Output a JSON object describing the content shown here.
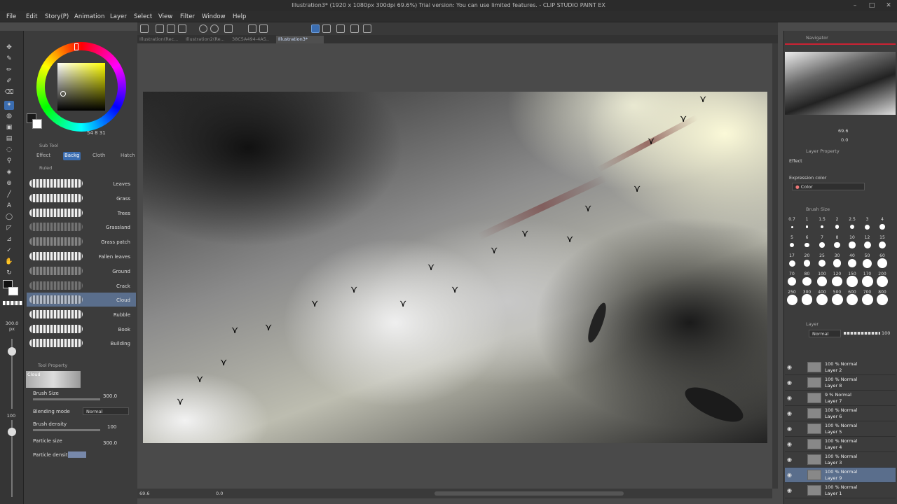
{
  "window": {
    "title": "Illustration3* (1920 x 1080px 300dpi 69.6%)  Trial version: You can use limited features. - CLIP STUDIO PAINT EX",
    "controls": [
      "–",
      "□",
      "✕"
    ]
  },
  "menu": [
    "File",
    "Edit",
    "Story(P)",
    "Animation",
    "Layer",
    "Select",
    "View",
    "Filter",
    "Window",
    "Help"
  ],
  "tabs": [
    {
      "label": "Illustration(Rec..."
    },
    {
      "label": "Illustration2(Re..."
    },
    {
      "label": "38C5A494-4A5..."
    },
    {
      "label": "Illustration3*"
    }
  ],
  "color": {
    "values": "54 8 31",
    "primary": "#1a1a1a",
    "secondary": "#ffffff",
    "hue_color": "#ffff00"
  },
  "subtool": {
    "header": "Sub Tool",
    "tabs": [
      "Effect",
      "Backg",
      "Cloth",
      "Hatch"
    ],
    "group": "Ruled",
    "brushes": [
      "Leaves",
      "Grass",
      "Trees",
      "Grassland",
      "Grass patch",
      "Fallen leaves",
      "Ground",
      "Crack",
      "Cloud",
      "Rubble",
      "Book",
      "Building"
    ],
    "selected": "Cloud"
  },
  "tool_property": {
    "header": "Tool Property",
    "preview_label": "Cloud",
    "brush_size_label": "Brush Size",
    "brush_size_value": "300.0",
    "blending_mode_label": "Blending mode",
    "blending_mode_value": "Normal",
    "brush_density_label": "Brush density",
    "brush_density_value": "100",
    "particle_size_label": "Particle size",
    "particle_size_value": "300.0",
    "particle_density_label": "Particle density"
  },
  "left_sliders": {
    "size_value": "300.0",
    "size_unit": "px",
    "opacity_value": "100"
  },
  "status": {
    "zoom": "69.6",
    "rotation": "0.0"
  },
  "navigator": {
    "header": "Navigator",
    "zoom": "69.6",
    "rotation": "0.0"
  },
  "layer_property": {
    "header": "Layer Property",
    "effect_label": "Effect",
    "expression_color_label": "Expression color",
    "expression_color_value": "Color"
  },
  "brush_size_panel": {
    "header": "Brush Size",
    "sizes": [
      "0.7",
      "1",
      "1.5",
      "2",
      "2.5",
      "3",
      "4",
      "5",
      "6",
      "7",
      "8",
      "10",
      "12",
      "15",
      "17",
      "20",
      "25",
      "30",
      "40",
      "50",
      "60",
      "70",
      "80",
      "100",
      "120",
      "150",
      "170",
      "200",
      "250",
      "300",
      "400",
      "500",
      "600",
      "700",
      "800"
    ]
  },
  "layer_panel": {
    "header": "Layer",
    "blend_mode": "Normal",
    "opacity": "100",
    "layers": [
      {
        "opacity_blend": "100 % Normal",
        "name": "Layer 2"
      },
      {
        "opacity_blend": "100 % Normal",
        "name": "Layer 8"
      },
      {
        "opacity_blend": "9 % Normal",
        "name": "Layer 7"
      },
      {
        "opacity_blend": "100 % Normal",
        "name": "Layer 6"
      },
      {
        "opacity_blend": "100 % Normal",
        "name": "Layer 5"
      },
      {
        "opacity_blend": "100 % Normal",
        "name": "Layer 4"
      },
      {
        "opacity_blend": "100 % Normal",
        "name": "Layer 3"
      },
      {
        "opacity_blend": "100 % Normal",
        "name": "Layer 9"
      },
      {
        "opacity_blend": "100 % Normal",
        "name": "Layer 1"
      }
    ],
    "selected": "Layer 9"
  }
}
